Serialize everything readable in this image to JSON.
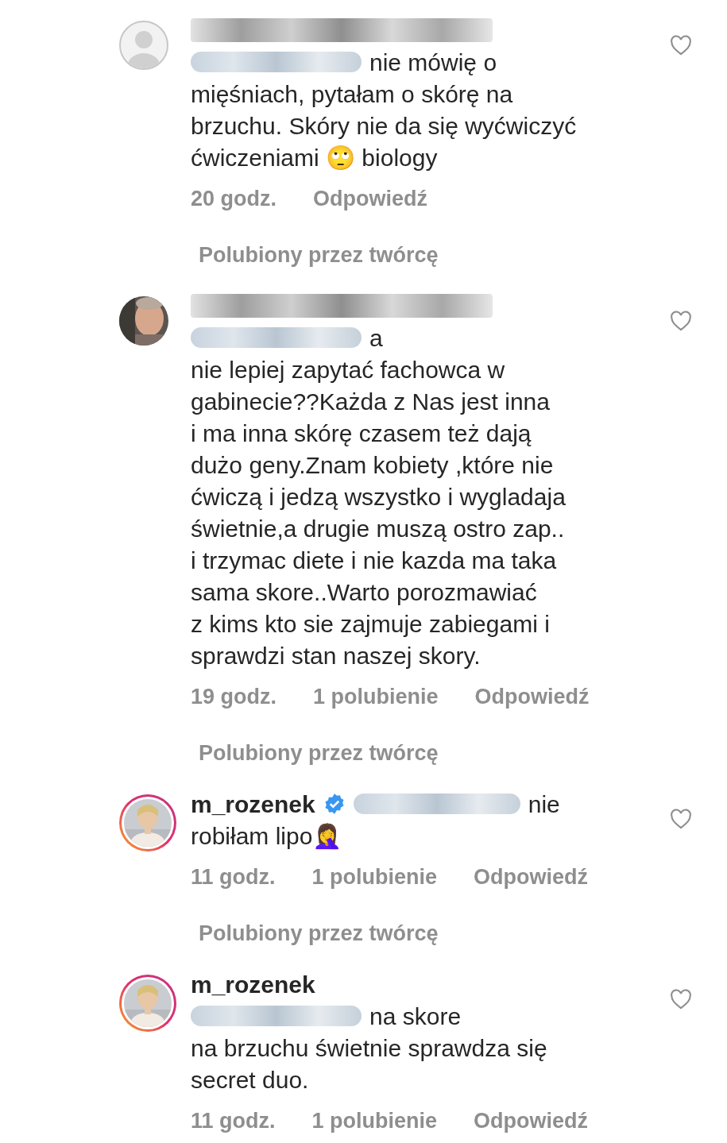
{
  "comments": [
    {
      "avatar": {
        "kind": "default"
      },
      "lines": [
        {
          "redacted_name": true
        },
        {
          "redacted_mention": true,
          "text": "nie mówię o"
        },
        {
          "text": "mięśniach, pytałam o skórę na"
        },
        {
          "text": "brzuchu. Skóry nie da się wyćwiczyć"
        },
        {
          "text": "ćwiczeniami 🙄 biology"
        }
      ],
      "time": "20 godz.",
      "reply": "Odpowiedź",
      "liked_by_creator": "Polubiony przez twórcę"
    },
    {
      "lines": [
        {
          "redacted_name": true
        },
        {
          "redacted_mention": true,
          "text": "a"
        },
        {
          "text": "nie lepiej zapytać fachowca w"
        },
        {
          "text": "gabinecie??Każda z Nas jest inna"
        },
        {
          "text": "i ma inna skórę czasem też dają"
        },
        {
          "text": "dużo geny.Znam kobiety ,które nie"
        },
        {
          "text": "ćwiczą i jedzą wszystko i wygladaja"
        },
        {
          "text": "świetnie,a drugie muszą ostro zap.."
        },
        {
          "text": "i trzymac diete i nie kazda ma taka"
        },
        {
          "text": "sama skore..Warto porozmawiać"
        },
        {
          "text": "z kims kto sie zajmuje zabiegami i"
        },
        {
          "text": "sprawdzi stan naszej skory."
        }
      ],
      "time": "19 godz.",
      "likes": "1 polubienie",
      "reply": "Odpowiedź",
      "liked_by_creator": "Polubiony przez twórcę"
    },
    {
      "avatar": {
        "kind": "story_ring"
      },
      "lines": [
        {
          "username": "m_rozenek",
          "verified": true,
          "redacted_mention": true,
          "text": "nie"
        },
        {
          "text": "robiłam lipo🤦‍♀️"
        }
      ],
      "time": "11 godz.",
      "likes": "1 polubienie",
      "reply": "Odpowiedź",
      "liked_by_creator": "Polubiony przez twórcę"
    },
    {
      "avatar": {
        "kind": "story_ring"
      },
      "lines": [
        {
          "username": "m_rozenek"
        },
        {
          "redacted_mention": true,
          "text": "na skore"
        },
        {
          "text": "na brzuchu świetnie sprawdza się"
        },
        {
          "text": "secret duo."
        }
      ],
      "time": "11 godz.",
      "likes": "1 polubienie",
      "reply": "Odpowiedź"
    }
  ]
}
